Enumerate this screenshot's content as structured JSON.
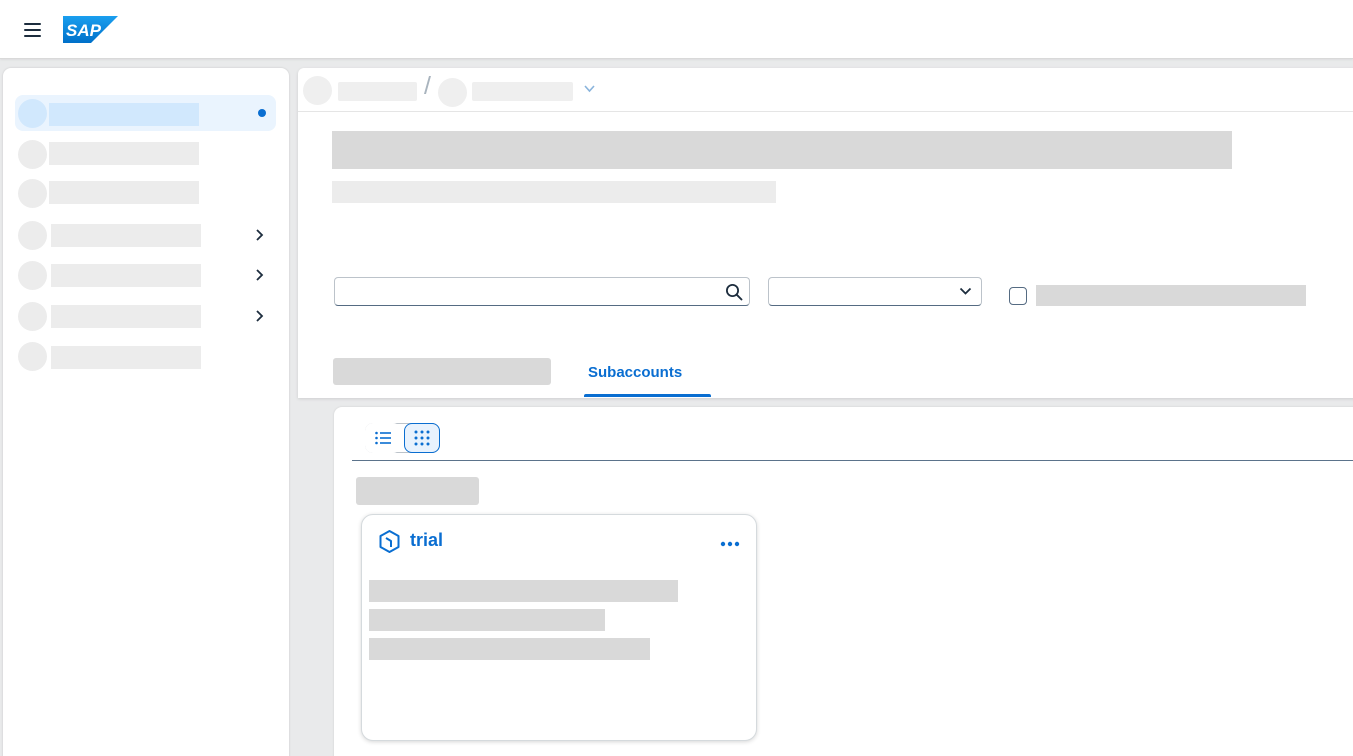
{
  "shell": {
    "menu_icon": "hamburger-menu-icon",
    "logo_text": "SAP",
    "logo_color": "#0a6ed1"
  },
  "sidebar": {
    "items": [
      {
        "selected": true,
        "has_children": false,
        "badge": "dot"
      },
      {
        "selected": false,
        "has_children": false
      },
      {
        "selected": false,
        "has_children": false
      },
      {
        "selected": false,
        "has_children": true
      },
      {
        "selected": false,
        "has_children": true
      },
      {
        "selected": false,
        "has_children": true
      },
      {
        "selected": false,
        "has_children": false
      }
    ]
  },
  "breadcrumb": {
    "separator": "/"
  },
  "filters": {
    "search_placeholder": "",
    "search_value": "",
    "select_value": ""
  },
  "tabs": {
    "active_label": "Subaccounts"
  },
  "subaccounts": {
    "view_modes": [
      "list",
      "tiles"
    ],
    "active_view": "tiles",
    "cards": [
      {
        "title": "trial",
        "icon": "subaccount-icon",
        "menu_icon": "more-options-icon"
      }
    ]
  },
  "colors": {
    "accent": "#0a6ed1",
    "placeholder_dark": "#d9d9d9",
    "placeholder_light": "#ececec",
    "selected_bg": "#eaf4fe"
  }
}
